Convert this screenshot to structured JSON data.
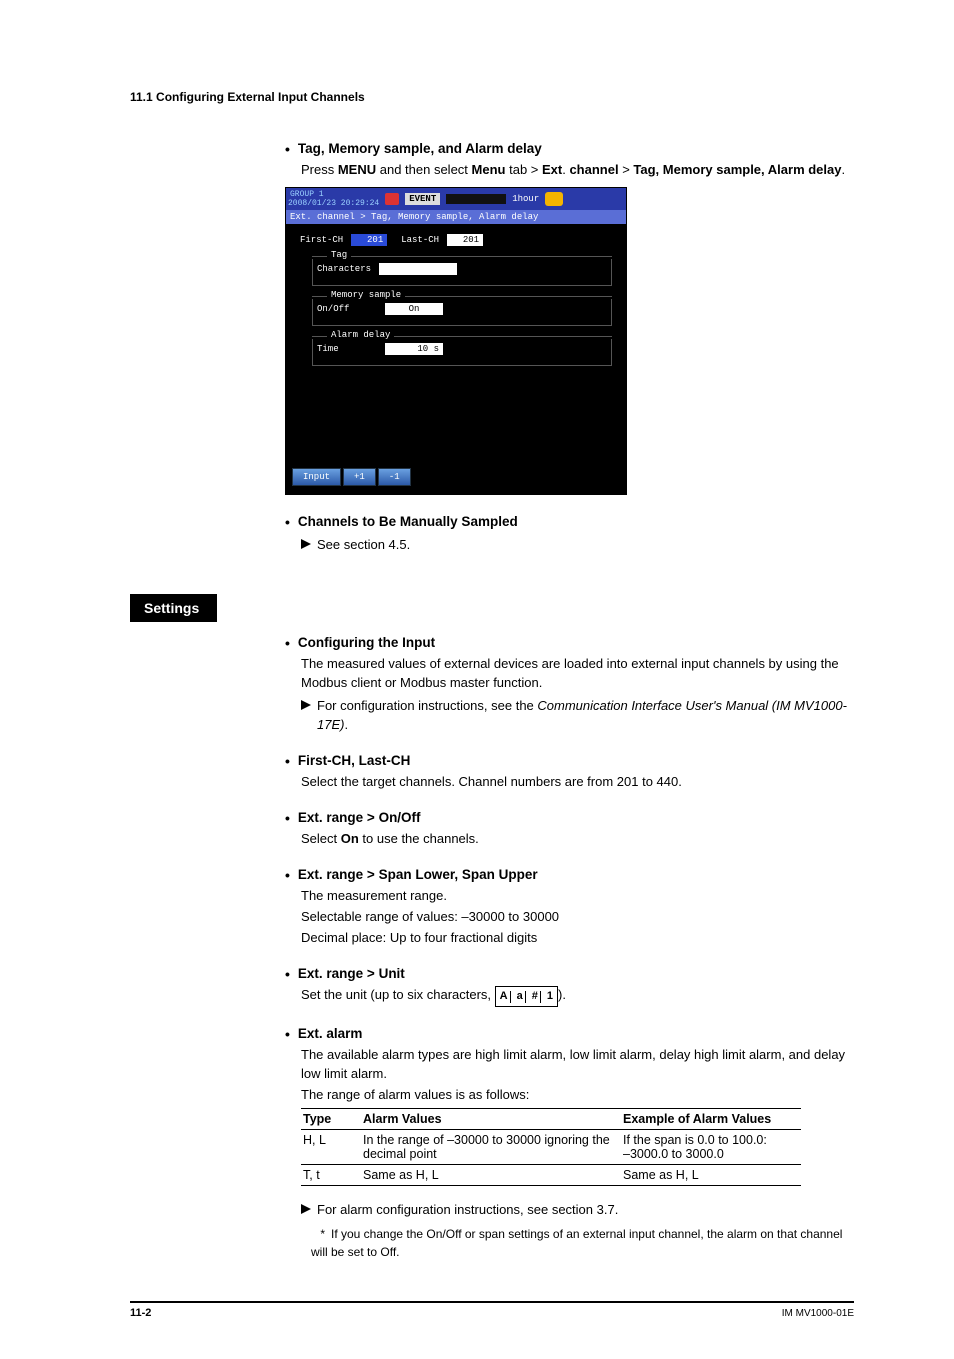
{
  "header": "11.1  Configuring External Input Channels",
  "s1": {
    "title": "Tag, Memory sample, and Alarm delay",
    "text": [
      "Press ",
      "MENU",
      " and then select ",
      "Menu",
      " tab > ",
      "Ext",
      ". ",
      "channel",
      " > ",
      "Tag, Memory sample, Alarm delay",
      "."
    ]
  },
  "shot": {
    "group": "GROUP 1",
    "datetime": "2008/01/23 20:29:24",
    "event": "EVENT",
    "hour": "1hour",
    "breadcrumb": "Ext. channel > Tag, Memory sample, Alarm delay",
    "firstch_label": "First-CH",
    "firstch_val": "201",
    "lastch_label": "Last-CH",
    "lastch_val": "201",
    "grp_tag": "Tag",
    "chars_label": "Characters",
    "grp_mem": "Memory sample",
    "onoff_label": "On/Off",
    "onoff_val": "On",
    "grp_delay": "Alarm delay",
    "time_label": "Time",
    "time_val": "10 s",
    "btn_input": "Input",
    "btn_plus": "+1",
    "btn_minus": "-1"
  },
  "s2": {
    "title": "Channels to Be Manually Sampled",
    "ref": "See section 4.5."
  },
  "settings_label": "Settings",
  "s3": {
    "title": "Configuring the Input",
    "p1": "The measured values of external devices are loaded into external input channels by using the Modbus client or Modbus master function.",
    "ref_a": "For configuration instructions, see the ",
    "ref_b": "Communication Interface User's Manual (IM MV1000-17E)",
    "ref_c": "."
  },
  "s4": {
    "title": "First-CH, Last-CH",
    "p": "Select the target channels. Channel numbers are from 201 to 440."
  },
  "s5": {
    "title": "Ext. range > On/Off",
    "p_a": "Select ",
    "p_b": "On",
    "p_c": " to use the channels."
  },
  "s6": {
    "title": "Ext. range > Span Lower, Span Upper",
    "p1": "The measurement range.",
    "p2": "Selectable range of values: –30000 to 30000",
    "p3": "Decimal place: Up to four fractional digits"
  },
  "s7": {
    "title": "Ext. range > Unit",
    "p_a": "Set the unit (up to six characters, ",
    "p_b": ")."
  },
  "s8": {
    "title": "Ext. alarm",
    "p1": "The available alarm types are high limit alarm, low limit alarm, delay high limit alarm, and delay low limit alarm.",
    "p2": "The range of alarm values is as follows:",
    "table": {
      "h1": "Type",
      "h2": "Alarm Values",
      "h3": "Example of Alarm Values",
      "r1c1": "H, L",
      "r1c2": "In the range of –30000 to 30000 ignoring the decimal point",
      "r1c3a": "If the span is 0.0 to 100.0:",
      "r1c3b": "–3000.0 to 3000.0",
      "r2c1": "T, t",
      "r2c2": "Same as H, L",
      "r2c3": "Same as H, L"
    },
    "ref": "For alarm configuration instructions, see section 3.7.",
    "note": "If you change the On/Off or span settings of an external input channel, the alarm on that channel will be set to Off."
  },
  "footer": {
    "page": "11-2",
    "doc": "IM MV1000-01E"
  }
}
